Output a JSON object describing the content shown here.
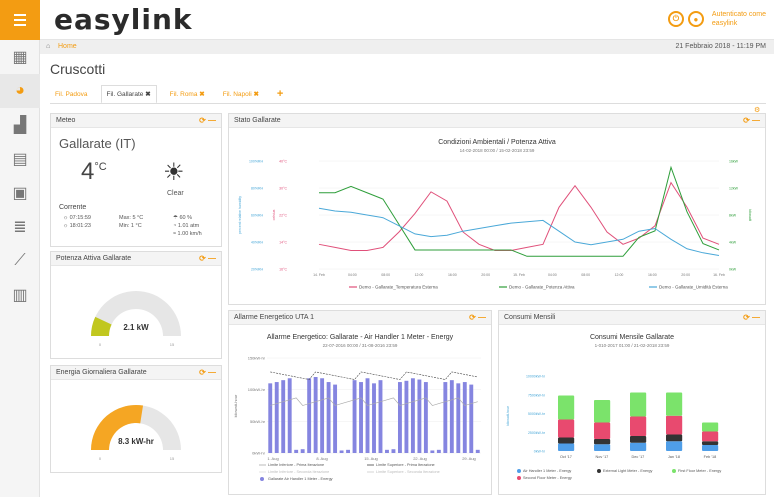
{
  "app": {
    "logo": "easylink",
    "auth_line1": "Autenticato come",
    "auth_line2": "easylink"
  },
  "breadcrumb": {
    "home": "Home",
    "date": "21 Febbraio 2018 - 11:19 PM"
  },
  "page": {
    "title": "Cruscotti"
  },
  "tabs": [
    {
      "label": "Fil. Padova",
      "close": ""
    },
    {
      "label": "Fil. Gallarate",
      "close": "✖"
    },
    {
      "label": "Fil. Roma",
      "close": "✖"
    },
    {
      "label": "Fil. Napoli",
      "close": "✖"
    }
  ],
  "add_tab": "+",
  "panel_ctl": "⟳ —",
  "meteo": {
    "header": "Meteo",
    "city": "Gallarate (IT)",
    "temp": "4",
    "unit": "°C",
    "cond": "Clear",
    "current": "Corrente",
    "sunrise": "07:15:59",
    "sunset": "18:01:23",
    "max": "Max: 5 °C",
    "min": "Min: 1 °C",
    "humidity": "60 %",
    "pressure": "1.01 atm",
    "wind": "1.00 km/h"
  },
  "potenza": {
    "header": "Potenza Attiva Gallarate",
    "value": "2.1 kW",
    "min": "0",
    "max": "15",
    "level": 0.14
  },
  "energia": {
    "header": "Energia Giornaliera Gallarate",
    "value": "8.3 kW-hr",
    "min": "0",
    "max": "15",
    "level": 0.55
  },
  "stato": {
    "header": "Stato Gallarate"
  },
  "allarme": {
    "header": "Allarme Energetico UTA 1"
  },
  "consumi": {
    "header": "Consumi Mensili"
  },
  "chart_data": [
    {
      "type": "line",
      "title": "Condizioni Ambientali / Potenza Attiva",
      "subtitle": "14-02-2018 00:00 / 15-02-2018 23:59",
      "x": [
        "14. Feb",
        "04:00",
        "08:00",
        "12:00",
        "16:00",
        "20:00",
        "15. Feb",
        "04:00",
        "08:00",
        "12:00",
        "16:00",
        "20:00",
        "16. Feb"
      ],
      "y_left_ticks": [
        "100%RH",
        "80%RH",
        "60%RH",
        "40%RH",
        "20%RH"
      ],
      "y_left_label": "percent relative humidity",
      "y_mid_ticks": [
        "40°C",
        "30°C",
        "22°C",
        "14°C",
        "16°C"
      ],
      "y_mid_label": "celsius",
      "y_right_ticks": [
        "16kW",
        "12kW",
        "8kW",
        "4kW",
        "0kW"
      ],
      "y_right_label": "kilowatt",
      "series": [
        {
          "name": "Demo - Gallarate_Temperatura Esterna",
          "color": "#e0507a",
          "values": [
            18,
            17,
            16,
            16,
            17,
            22,
            28,
            35,
            32,
            22,
            18,
            16,
            16,
            17,
            18,
            30,
            37,
            30,
            22,
            18,
            20,
            24,
            38,
            30,
            20,
            18
          ]
        },
        {
          "name": "Demo - Gallarate_Potenza Attiva",
          "color": "#2e9e3a",
          "values": [
            12,
            12,
            13,
            12,
            11,
            7,
            3,
            3,
            3,
            3,
            3,
            3,
            3,
            2,
            2,
            2,
            2,
            2,
            2,
            2,
            5,
            6,
            16,
            9,
            4,
            3
          ]
        },
        {
          "name": "Demo - Gallarate_Umidità Esterna",
          "color": "#4aa8d8",
          "values": [
            65,
            63,
            62,
            60,
            58,
            52,
            46,
            44,
            45,
            48,
            50,
            52,
            54,
            55,
            56,
            48,
            40,
            38,
            40,
            42,
            48,
            50,
            42,
            35,
            32,
            30
          ]
        }
      ]
    },
    {
      "type": "bar",
      "title": "Allarme Energetico: Gallarate - Air Handler 1 Meter - Energy",
      "subtitle": "22-07-2016 00:00 / 31-08-2016 23:59",
      "x_ticks": [
        "1. Aug",
        "8. Aug",
        "15. Aug",
        "22. Aug",
        "29. Aug"
      ],
      "y_ticks": [
        "150kW-hr",
        "100kW-hr",
        "50kW-hr",
        "0kW-hr"
      ],
      "ylabel": "kilowatt-hour",
      "ylim": [
        0,
        150
      ],
      "legend": [
        "Limite Inferiore - Prima Iterazione",
        "Limite Superiore - Prima Iterazione",
        "Limite Inferiore - Seconda Iterazione",
        "Limite Superiore - Seconda Iterazione",
        "Gallarate Air Handler 1 Meter - Energy"
      ],
      "series": [
        {
          "name": "Gallarate Air Handler 1 Meter - Energy",
          "color": "#8585e0",
          "values": [
            110,
            112,
            115,
            118,
            5,
            6,
            118,
            120,
            118,
            112,
            108,
            4,
            5,
            115,
            112,
            118,
            110,
            115,
            5,
            6,
            112,
            114,
            118,
            116,
            112,
            4,
            5,
            112,
            115,
            110,
            112,
            108,
            5
          ]
        }
      ]
    },
    {
      "type": "bar",
      "title": "Consumi Mensile Gallarate",
      "subtitle": "1-010-2017 01:00 / 21-02-2018 23:59",
      "categories": [
        "Oct '17",
        "Nov '17",
        "Dec '17",
        "Jan '18",
        "Feb '18"
      ],
      "y_ticks": [
        "10000kW-hr",
        "7500kW-hr",
        "5000kW-hr",
        "2500kW-hr",
        "0kW-hr"
      ],
      "ylabel": "kilowatt-hour",
      "series": [
        {
          "name": "Air Handler 1 Meter - Energy",
          "color": "#4f9ee8",
          "values": [
            1000,
            900,
            1100,
            1300,
            800
          ]
        },
        {
          "name": "External Light Meter - Energy",
          "color": "#333333",
          "values": [
            800,
            700,
            900,
            900,
            500
          ]
        },
        {
          "name": "First Floor Meter - Energy",
          "color": "#7be36b",
          "values": [
            3200,
            3000,
            3200,
            3100,
            1200
          ]
        },
        {
          "name": "Second Floor Meter - Energy",
          "color": "#e84a6f",
          "values": [
            2400,
            2200,
            2600,
            2500,
            1300
          ]
        }
      ]
    }
  ]
}
